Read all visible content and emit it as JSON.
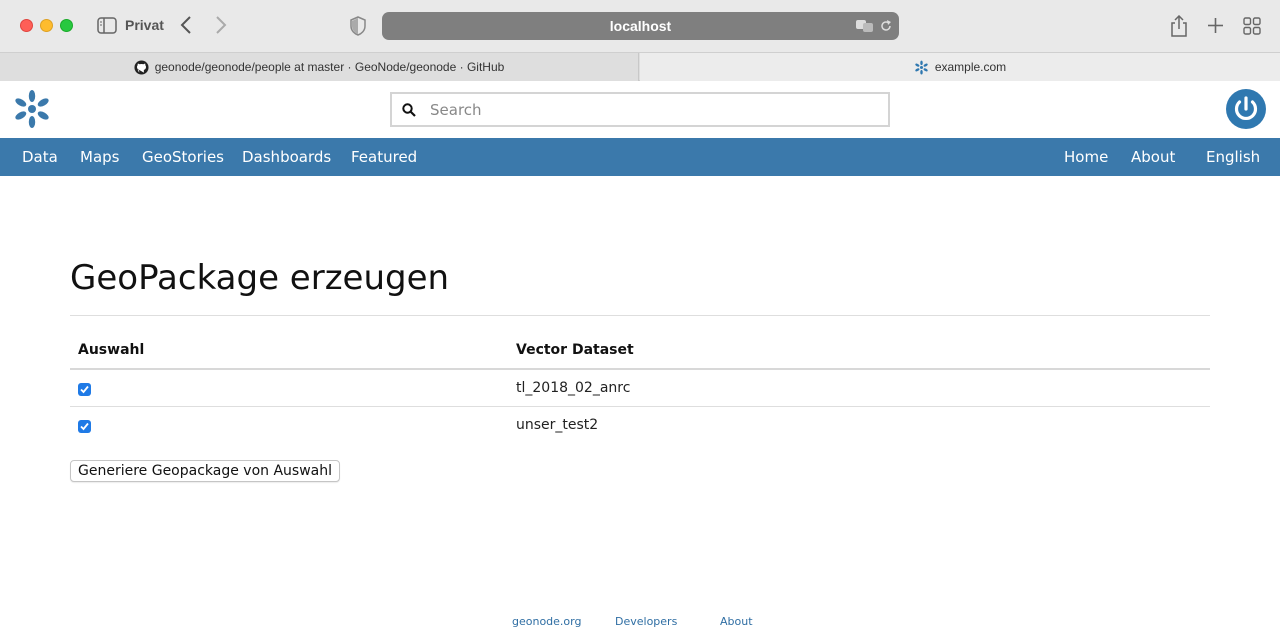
{
  "browser": {
    "private_label": "Privat",
    "url": "localhost",
    "tabs": [
      {
        "title": "geonode/geonode/people at master · GeoNode/geonode · GitHub",
        "icon": "github-icon"
      },
      {
        "title": "example.com",
        "icon": "geonode-icon"
      }
    ]
  },
  "header": {
    "search_placeholder": "Search",
    "nav_left": [
      "Data",
      "Maps",
      "GeoStories",
      "Dashboards",
      "Featured"
    ],
    "nav_right": [
      "Home",
      "About",
      "English"
    ]
  },
  "main": {
    "title": "GeoPackage erzeugen",
    "columns": [
      "Auswahl",
      "Vector Dataset"
    ],
    "rows": [
      {
        "checked": true,
        "dataset": "tl_2018_02_anrc"
      },
      {
        "checked": true,
        "dataset": "unser_test2"
      }
    ],
    "submit_label": "Generiere Geopackage von Auswahl"
  },
  "footer": {
    "links": [
      "geonode.org",
      "Developers",
      "About"
    ]
  },
  "colors": {
    "navbar": "#3b79ab",
    "accent": "#2f78b0",
    "checkbox": "#1f7ae6"
  }
}
